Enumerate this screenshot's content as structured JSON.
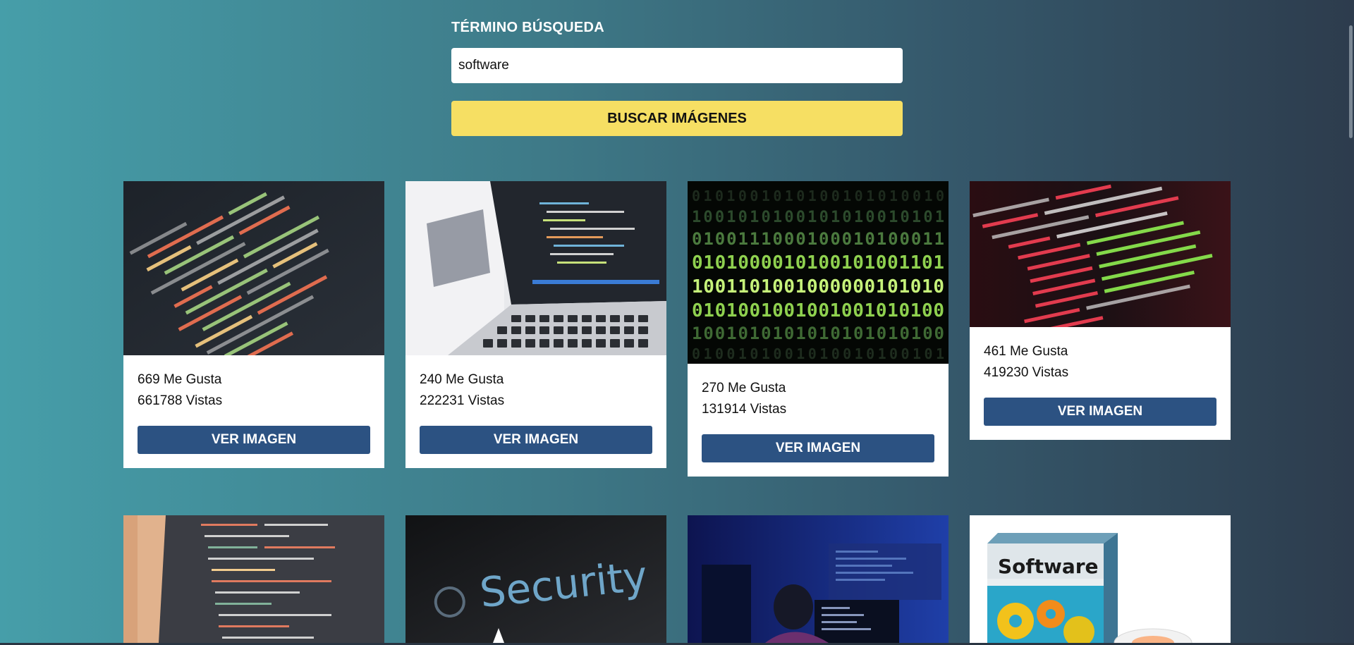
{
  "search": {
    "label": "TÉRMINO BÚSQUEDA",
    "value": "software",
    "button_label": "BUSCAR IMÁGENES"
  },
  "results": [
    {
      "likes": "669 Me Gusta",
      "views": "661788 Vistas",
      "button_label": "VER IMAGEN"
    },
    {
      "likes": "240 Me Gusta",
      "views": "222231 Vistas",
      "button_label": "VER IMAGEN"
    },
    {
      "likes": "270 Me Gusta",
      "views": "131914 Vistas",
      "button_label": "VER IMAGEN"
    },
    {
      "likes": "461 Me Gusta",
      "views": "419230 Vistas",
      "button_label": "VER IMAGEN"
    }
  ],
  "images": {
    "security_text": "Security",
    "software_box_text": "Software"
  },
  "colors": {
    "search_button": "#f6df63",
    "view_button": "#2c5282",
    "card_background": "#ffffff"
  }
}
